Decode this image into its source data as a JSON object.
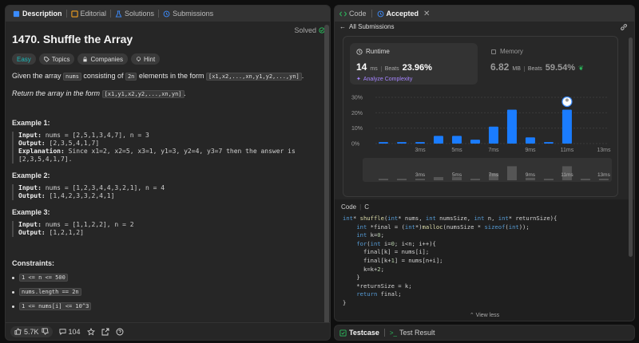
{
  "left_tabs": [
    "Description",
    "Editorial",
    "Solutions",
    "Submissions"
  ],
  "problem": {
    "title": "1470. Shuffle the Array",
    "solved": "Solved",
    "chips": [
      "Easy",
      "Topics",
      "Companies",
      "Hint"
    ],
    "desc_prefix": "Given the array",
    "desc_nums": "nums",
    "desc_mid": "consisting of",
    "desc_2n": "2n",
    "desc_mid2": "elements in the form",
    "desc_form": "[x1,x2,...,xn,y1,y2,...,yn]",
    "return_prefix": "Return the array in the form",
    "return_form": "[x1,y1,x2,y2,...,xn,yn]"
  },
  "examples": [
    {
      "title": "Example 1:",
      "input": "nums = [2,5,1,3,4,7], n = 3",
      "output": "[2,3,5,4,1,7]",
      "explanation": "Since x1=2, x2=5, x3=1, y1=3, y2=4, y3=7 then the answer is [2,3,5,4,1,7]."
    },
    {
      "title": "Example 2:",
      "input": "nums = [1,2,3,4,4,3,2,1], n = 4",
      "output": "[1,4,2,3,3,2,4,1]"
    },
    {
      "title": "Example 3:",
      "input": "nums = [1,1,2,2], n = 2",
      "output": "[1,2,1,2]"
    }
  ],
  "labels": {
    "input": "Input:",
    "output": "Output:",
    "explanation": "Explanation:"
  },
  "constraints_title": "Constraints:",
  "constraints": [
    "1 <= n <= 500",
    "nums.length == 2n",
    "1 <= nums[i] <= 10^3"
  ],
  "footer": {
    "likes": "5.7K",
    "comments": "104"
  },
  "right_tabs": {
    "code": "Code",
    "accepted": "Accepted"
  },
  "back_label": "All Submissions",
  "runtime": {
    "label": "Runtime",
    "value": "14",
    "unit": "ms",
    "beats_label": "Beats",
    "beats": "23.96%",
    "analyze": "Analyze Complexity"
  },
  "memory": {
    "label": "Memory",
    "value": "6.82",
    "unit": "MB",
    "beats_label": "Beats",
    "beats": "59.54%"
  },
  "chart_data": {
    "type": "bar",
    "categories": [
      "",
      "",
      "3ms",
      "",
      "5ms",
      "",
      "7ms",
      "",
      "9ms",
      "",
      "11ms",
      "",
      "13ms"
    ],
    "values": [
      1,
      1,
      1,
      5,
      5,
      2.5,
      11,
      22,
      4,
      1,
      22,
      0,
      0
    ],
    "yticks": [
      "0%",
      "10%",
      "20%",
      "30%"
    ],
    "ylim": [
      0,
      30
    ],
    "highlight_index": 10
  },
  "editor": {
    "label": "Code",
    "lang": "C",
    "view_less": "View less"
  },
  "testbar": {
    "testcase": "Testcase",
    "result": "Test Result"
  },
  "colors": {
    "accent_green": "#2cbb5d",
    "bar_blue": "#1a7cff",
    "easy": "#1cbaba"
  }
}
